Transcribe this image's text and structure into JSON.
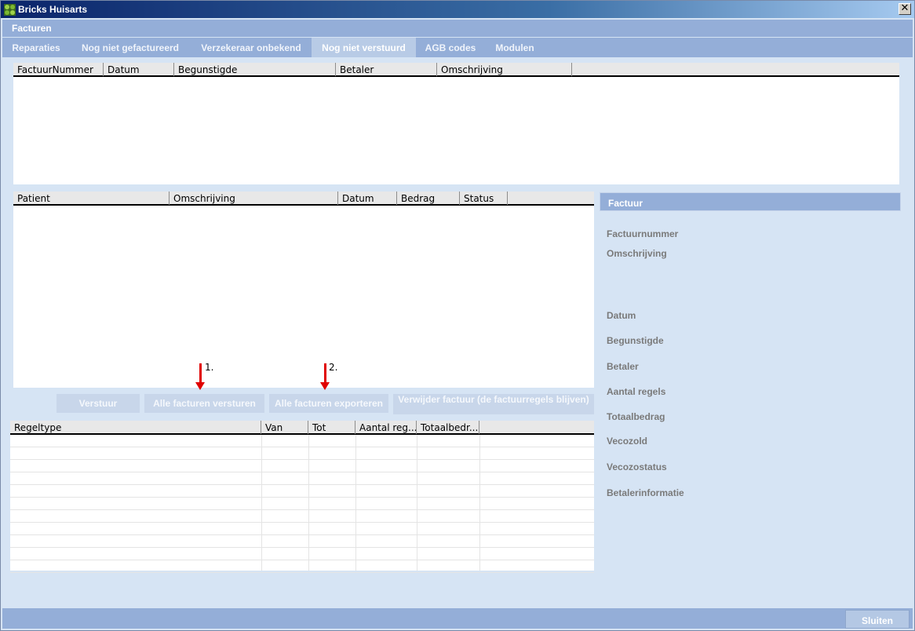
{
  "window": {
    "title": "Bricks Huisarts",
    "close_glyph": "✕",
    "icon": "app-leaf-icon"
  },
  "section": {
    "title": "Facturen"
  },
  "tabs": [
    {
      "label": "Reparaties",
      "active": false
    },
    {
      "label": "Nog niet gefactureerd",
      "active": false
    },
    {
      "label": "Verzekeraar onbekend",
      "active": false
    },
    {
      "label": "Nog niet verstuurd",
      "active": true
    },
    {
      "label": "AGB codes",
      "active": false
    },
    {
      "label": "Modulen",
      "active": false
    }
  ],
  "invoice_table": {
    "columns": [
      "FactuurNummer",
      "Datum",
      "Begunstigde",
      "Betaler",
      "Omschrijving"
    ],
    "rows": []
  },
  "patient_table": {
    "columns": [
      "Patient",
      "Omschrijving",
      "Datum",
      "Bedrag",
      "Status"
    ],
    "rows": []
  },
  "annotations": {
    "first": "1.",
    "second": "2."
  },
  "actions": {
    "send": "Verstuur",
    "send_all": "Alle facturen versturen",
    "export_all": "Alle facturen exporteren",
    "delete": "Verwijder factuur (de factuurregels blijven)"
  },
  "lines_table": {
    "columns": [
      "Regeltype",
      "Van",
      "Tot",
      "Aantal reg...",
      "Totaalbedr..."
    ],
    "rows": []
  },
  "detail_panel": {
    "header": "Factuur",
    "fields": [
      "Factuurnummer",
      "Omschrijving",
      "Datum",
      "Begunstigde",
      "Betaler",
      "Aantal regels",
      "Totaalbedrag",
      "Vecozold",
      "Vecozostatus",
      "Betalerinformatie"
    ]
  },
  "footer": {
    "close_label": "Sluiten"
  },
  "colors": {
    "accent": "#94aed8",
    "background": "#d6e4f4",
    "annotation_arrow": "#e00000"
  }
}
